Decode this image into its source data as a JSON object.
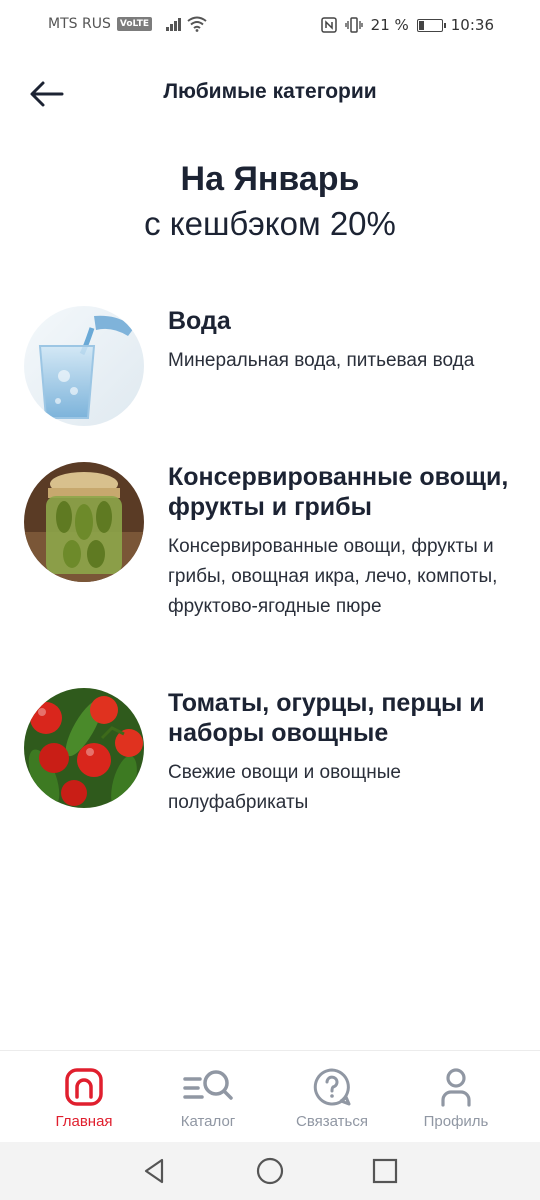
{
  "status_bar": {
    "carrier": "MTS RUS",
    "volte": "VoLTE",
    "battery_percent": "21 %",
    "time": "10:36",
    "battery_level": 0.21
  },
  "header": {
    "title": "Любимые категории"
  },
  "hero": {
    "line1": "На Январь",
    "line2": "с кешбэком 20%"
  },
  "categories": [
    {
      "title": "Вода",
      "description": "Минеральная вода, питьевая вода",
      "icon": "water-glass-image"
    },
    {
      "title": "Консервированные овощи, фрукты и грибы",
      "description": "Консервированные овощи, фрукты и грибы, овощная икра, лечо, компоты, фруктово-ягодные пюре",
      "icon": "pickle-jar-image"
    },
    {
      "title": "Томаты, огурцы, перцы и наборы овощные",
      "description": "Свежие овощи и овощные полуфабрикаты",
      "icon": "tomatoes-cucumbers-image"
    }
  ],
  "bottom_nav": {
    "items": [
      {
        "label": "Главная",
        "icon": "home-icon",
        "active": true
      },
      {
        "label": "Каталог",
        "icon": "catalog-search-icon",
        "active": false
      },
      {
        "label": "Связаться",
        "icon": "chat-question-icon",
        "active": false
      },
      {
        "label": "Профиль",
        "icon": "profile-icon",
        "active": false
      }
    ]
  },
  "colors": {
    "accent": "#e01f2e",
    "text": "#1c2333",
    "nav_inactive": "#9097a3"
  }
}
